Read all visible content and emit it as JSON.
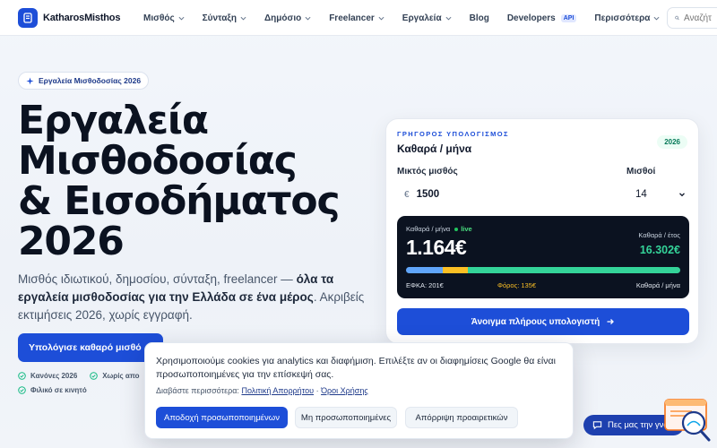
{
  "brand": {
    "name": "KatharosMisthos"
  },
  "nav": {
    "items": [
      {
        "label": "Μισθός",
        "dropdown": true
      },
      {
        "label": "Σύνταξη",
        "dropdown": true
      },
      {
        "label": "Δημόσιο",
        "dropdown": true
      },
      {
        "label": "Freelancer",
        "dropdown": true
      },
      {
        "label": "Εργαλεία",
        "dropdown": true
      },
      {
        "label": "Blog",
        "dropdown": false
      },
      {
        "label": "Developers",
        "badge": "API"
      },
      {
        "label": "Περισσότερα",
        "dropdown": true
      }
    ],
    "search_placeholder": "Αναζήτ"
  },
  "hero": {
    "pill": "Εργαλεία Μισθοδοσίας 2026",
    "title_lines": [
      "Εργαλεία",
      "Μισθοδοσίας",
      "& Εισοδήματος",
      "2026"
    ],
    "subtitle_pre": "Μισθός ιδιωτικού, δημοσίου, σύνταξη, freelancer — ",
    "subtitle_bold": "όλα τα εργαλεία μισθοδοσίας για την Ελλάδα σε ένα μέρος",
    "subtitle_post": ". Ακριβείς εκτιμήσεις 2026, χωρίς εγγραφή.",
    "cta": "Υπολόγισε καθαρό μισθό",
    "checks": [
      "Κανόνες 2026",
      "Χωρίς απο",
      "Φιλικό σε κινητό"
    ]
  },
  "calculator": {
    "kicker": "ΓΡΗΓΟΡΟΣ ΥΠΟΛΟΓΙΣΜΟΣ",
    "title": "Καθαρά / μήνα",
    "year": "2026",
    "gross_label": "Μικτός μισθός",
    "currency": "€",
    "gross_value": "1500",
    "salaries_label": "Μισθοί",
    "salaries_value": "14",
    "result": {
      "net_label": "Καθαρά / μήνα",
      "live": "live",
      "net_value": "1.164€",
      "year_label": "Καθαρά / έτος",
      "year_value": "16.302€",
      "efka": "ΕΦΚΑ: 201€",
      "tax": "Φόρος: 135€",
      "net_short": "Καθαρά / μήνα",
      "efka_amount": 201,
      "tax_amount": 135,
      "net_amount": 1164
    },
    "open_button": "Άνοιγμα πλήρους υπολογιστή"
  },
  "colors": {
    "accent": "#1d4ed8",
    "efka": "#60a5fa",
    "tax": "#fbbf24",
    "net": "#34d399"
  },
  "cookie": {
    "text": "Χρησιμοποιούμε cookies για analytics και διαφήμιση. Επιλέξτε αν οι διαφημίσεις Google θα είναι προσωποποιημένες για την επίσκεψή σας.",
    "links_prefix": "Διαβάστε περισσότερα:",
    "privacy": "Πολιτική Απορρήτου",
    "separator": "·",
    "terms": "Όροι Χρήσης",
    "accept": "Αποδοχή προσωποποιημένων",
    "non_personalized": "Μη προσωποποιημένες",
    "reject": "Απόρριψη προαιρετικών"
  },
  "chat": {
    "label": "Πες μας την γνώμη"
  }
}
